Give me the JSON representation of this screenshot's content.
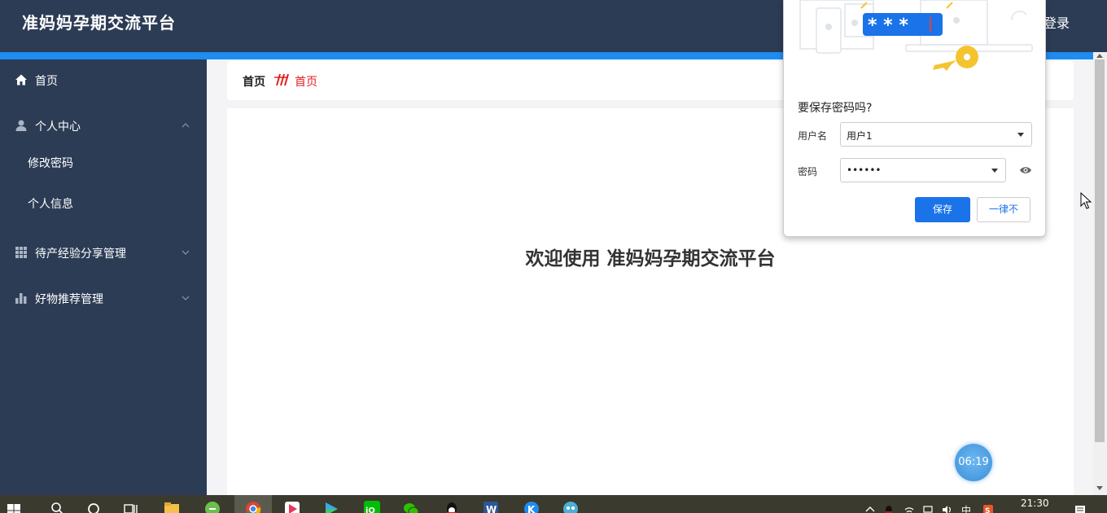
{
  "header": {
    "app_title": "准妈妈孕期交流平台",
    "logout_label": "退出登录"
  },
  "sidebar": {
    "items": [
      {
        "label": "首页",
        "icon": "home-icon"
      },
      {
        "label": "个人中心",
        "icon": "user-icon",
        "expanded": true,
        "children": [
          {
            "label": "修改密码"
          },
          {
            "label": "个人信息"
          }
        ]
      },
      {
        "label": "待产经验分享管理",
        "icon": "grid-icon",
        "expanded": false
      },
      {
        "label": "好物推荐管理",
        "icon": "bar-chart-icon",
        "expanded": false
      }
    ]
  },
  "breadcrumb": {
    "home": "首页",
    "current": "首页"
  },
  "main": {
    "welcome": "欢迎使用 准妈妈孕期交流平台"
  },
  "timer": {
    "time": "06:19"
  },
  "password_dialog": {
    "title": "要保存密码吗?",
    "username_label": "用户名",
    "username_value": "用户1",
    "password_label": "密码",
    "password_value": "••••••",
    "save_label": "保存",
    "never_label": "一律不"
  },
  "taskbar": {
    "time": "21:30",
    "ime": "中"
  },
  "colors": {
    "header": "#2c3c55",
    "accent_strip": "#1e8cf0",
    "breadcrumb_current": "#e02020",
    "primary_button": "#1a73e8"
  }
}
